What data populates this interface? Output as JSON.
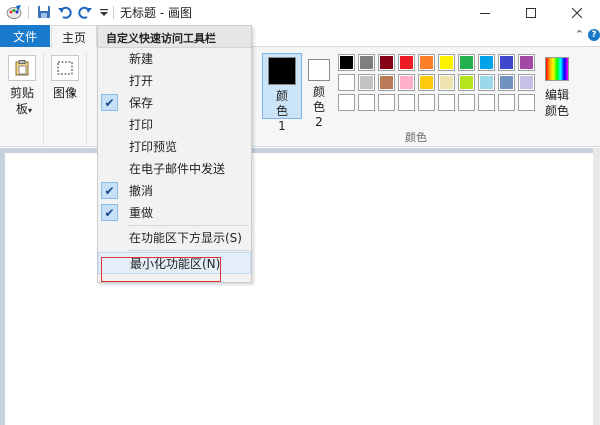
{
  "window": {
    "title": "无标题 - 画图"
  },
  "tabs": {
    "file": "文件",
    "home": "主页"
  },
  "ribbon": {
    "clipboard": "剪贴板",
    "image": "图像",
    "color1": "颜色 1",
    "color2": "颜色 2",
    "edit_colors": "编辑颜色",
    "color_group": "颜色"
  },
  "palette": {
    "row1": [
      "#000000",
      "#7f7f7f",
      "#880015",
      "#ed1c24",
      "#ff7f27",
      "#fff200",
      "#22b14c",
      "#00a2e8",
      "#3f48cc",
      "#a349a4"
    ],
    "row2": [
      "#ffffff",
      "#c3c3c3",
      "#b97a57",
      "#ffaec9",
      "#ffc90e",
      "#efe4b0",
      "#b5e61d",
      "#99d9ea",
      "#7092be",
      "#c8bfe7"
    ],
    "row3": [
      "",
      "",
      "",
      "",
      "",
      "",
      "",
      "",
      "",
      ""
    ]
  },
  "menu": {
    "header": "自定义快速访问工具栏",
    "items": [
      {
        "label": "新建",
        "checked": false
      },
      {
        "label": "打开",
        "checked": false
      },
      {
        "label": "保存",
        "checked": true
      },
      {
        "label": "打印",
        "checked": false
      },
      {
        "label": "打印预览",
        "checked": false
      },
      {
        "label": "在电子邮件中发送",
        "checked": false
      },
      {
        "label": "撤消",
        "checked": true
      },
      {
        "label": "重做",
        "checked": true
      }
    ],
    "show_below": "在功能区下方显示(S)",
    "minimize": "最小化功能区(N)"
  },
  "colors": {
    "accent": "#1979ca",
    "highlight": "#e03333",
    "canvas_bg": "#c8d1de"
  }
}
